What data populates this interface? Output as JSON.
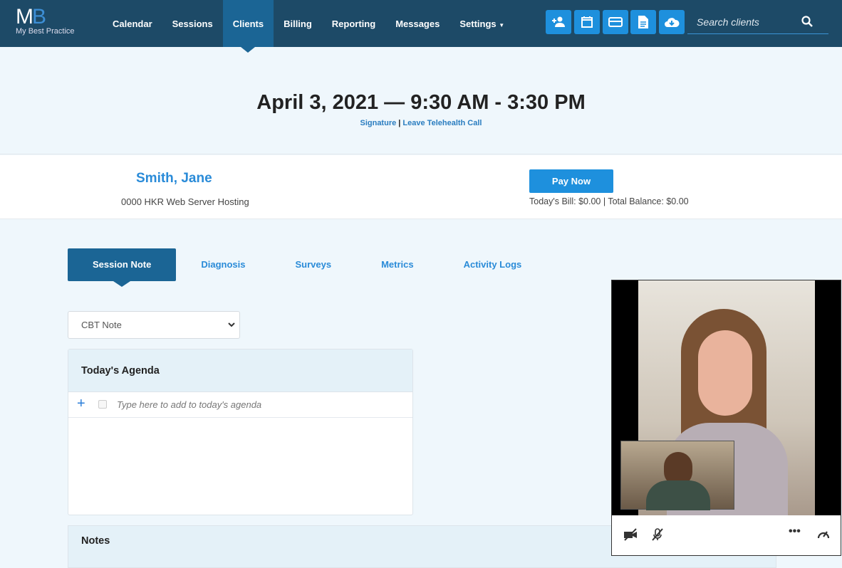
{
  "nav": {
    "logo_mark": "MB",
    "logo_text": "My Best Practice",
    "items": [
      {
        "label": "Calendar"
      },
      {
        "label": "Sessions"
      },
      {
        "label": "Clients",
        "active": true
      },
      {
        "label": "Billing"
      },
      {
        "label": "Reporting"
      },
      {
        "label": "Messages"
      },
      {
        "label": "Settings",
        "dropdown": true
      }
    ],
    "toolbar": [
      "add-client-icon",
      "calendar-icon",
      "credit-card-icon",
      "document-icon",
      "cloud-download-icon"
    ],
    "search_placeholder": "Search clients"
  },
  "session": {
    "title": "April 3, 2021 — 9:30 AM - 3:30 PM",
    "signature_link": "Signature",
    "separator": "|",
    "leave_link": "Leave Telehealth Call"
  },
  "client": {
    "name": "Smith, Jane",
    "location": "0000 HKR Web Server Hosting",
    "pay_label": "Pay Now",
    "billing": "Today's Bill: $0.00 | Total Balance: $0.00"
  },
  "tabs": [
    {
      "label": "Session Note",
      "active": true
    },
    {
      "label": "Diagnosis"
    },
    {
      "label": "Surveys"
    },
    {
      "label": "Metrics"
    },
    {
      "label": "Activity Logs"
    }
  ],
  "note_type": "CBT Note",
  "agenda": {
    "title": "Today's Agenda",
    "placeholder": "Type here to add to today's agenda"
  },
  "notes": {
    "title": "Notes"
  },
  "video": {
    "controls": [
      "video-off-icon",
      "mic-off-icon",
      "more-icon",
      "bandwidth-gauge-icon"
    ]
  },
  "colors": {
    "nav": "#1d4a67",
    "active": "#1b6595",
    "accent": "#1e90dd"
  }
}
